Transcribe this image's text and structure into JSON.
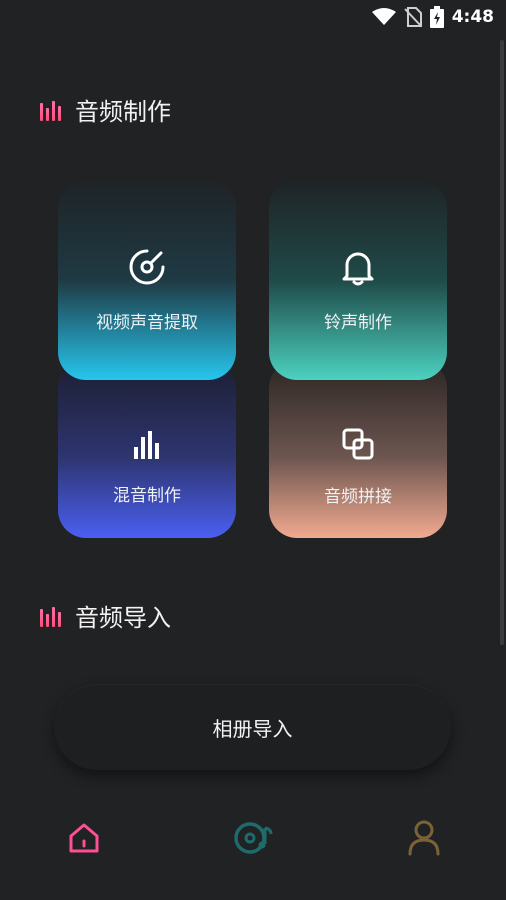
{
  "status": {
    "time": "4:48"
  },
  "section_make": {
    "title": "音频制作"
  },
  "cards": [
    {
      "label": "视频声音提取",
      "icon": "disc-icon"
    },
    {
      "label": "铃声制作",
      "icon": "bell-icon"
    },
    {
      "label": "混音制作",
      "icon": "equalizer-icon"
    },
    {
      "label": "音频拼接",
      "icon": "merge-icon"
    }
  ],
  "section_import": {
    "title": "音频导入"
  },
  "album_import": {
    "label": "相册导入"
  },
  "nav": [
    {
      "icon": "home-icon",
      "color": "#ff4f93"
    },
    {
      "icon": "music-disc-icon",
      "color": "#1f6b6b"
    },
    {
      "icon": "user-icon",
      "color": "#7b6336"
    }
  ],
  "colors": {
    "background": "#202224",
    "accent_pink": "#ff4f93"
  }
}
